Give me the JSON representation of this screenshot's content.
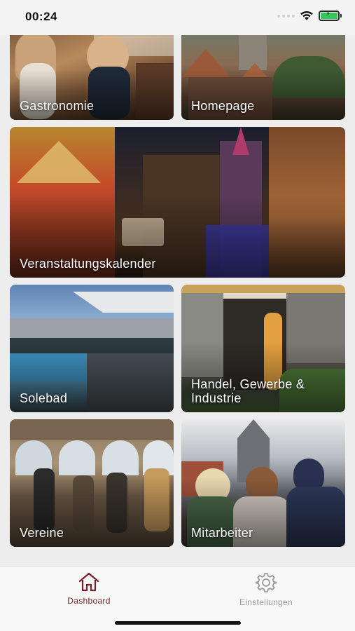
{
  "status_bar": {
    "time": "00:24",
    "icons": [
      "wifi-icon",
      "battery-charging-icon"
    ],
    "battery_level": 1.0
  },
  "tiles": [
    {
      "label": "Gastronomie"
    },
    {
      "label": "Homepage"
    },
    {
      "label": "Veranstaltungskalender"
    },
    {
      "label": "Solebad"
    },
    {
      "label": "Handel, Gewerbe & Industrie"
    },
    {
      "label": "Vereine"
    },
    {
      "label": "Mitarbeiter"
    }
  ],
  "tabbar": {
    "tabs": [
      {
        "label": "Dashboard",
        "icon": "home-icon",
        "active": true
      },
      {
        "label": "Einstellungen",
        "icon": "gear-icon",
        "active": false
      }
    ]
  },
  "colors": {
    "accent": "#7a1f2b",
    "inactive": "#9a9a9a",
    "background": "#ededed",
    "battery_fill": "#34c759"
  }
}
